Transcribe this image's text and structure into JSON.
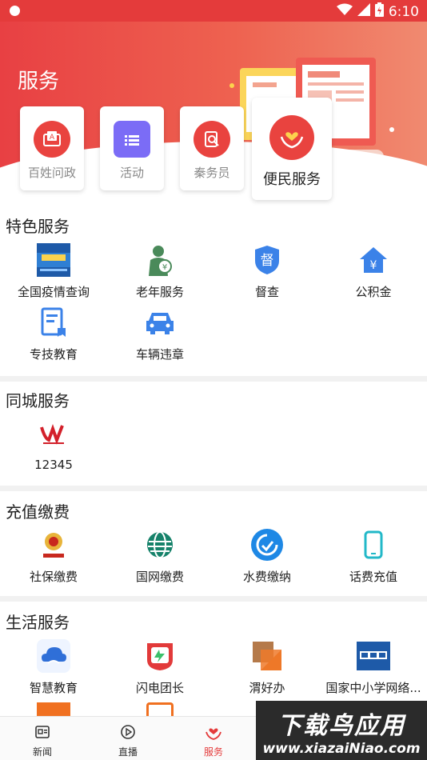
{
  "status_bar": {
    "time": "6:10"
  },
  "header": {
    "title": "服务"
  },
  "quick_links": [
    {
      "label": "百姓问政",
      "icon": "petition-icon",
      "color": "#e9433f"
    },
    {
      "label": "活动",
      "icon": "activity-icon",
      "color": "#7b6cf6"
    },
    {
      "label": "秦务员",
      "icon": "document-search-icon",
      "color": "#e9433f"
    },
    {
      "label": "便民服务",
      "icon": "heart-hands-icon",
      "color": "#e9433f"
    }
  ],
  "sections": {
    "featured": {
      "title": "特色服务",
      "items": [
        {
          "label": "全国疫情查询",
          "icon": "epidemic-map-icon"
        },
        {
          "label": "老年服务",
          "icon": "elderly-icon"
        },
        {
          "label": "督查",
          "icon": "supervision-badge-icon",
          "badge_text": "督"
        },
        {
          "label": "公积金",
          "icon": "housing-fund-icon",
          "badge_text": "¥"
        },
        {
          "label": "专技教育",
          "icon": "education-document-icon"
        },
        {
          "label": "车辆违章",
          "icon": "car-icon"
        }
      ]
    },
    "city": {
      "title": "同城服务",
      "items": [
        {
          "label": "12345",
          "icon": "hotline-logo-icon"
        }
      ]
    },
    "payment": {
      "title": "充值缴费",
      "items": [
        {
          "label": "社保缴费",
          "icon": "tax-emblem-icon"
        },
        {
          "label": "国网缴费",
          "icon": "state-grid-icon"
        },
        {
          "label": "水费缴纳",
          "icon": "water-drop-icon"
        },
        {
          "label": "话费充值",
          "icon": "phone-icon"
        }
      ]
    },
    "life": {
      "title": "生活服务",
      "items": [
        {
          "label": "智慧教育",
          "icon": "cloud-education-icon"
        },
        {
          "label": "闪电团长",
          "icon": "lightning-shop-icon"
        },
        {
          "label": "渭好办",
          "icon": "weihaoban-icon"
        },
        {
          "label": "国家中小学网络...",
          "icon": "cloud-platform-icon"
        }
      ]
    }
  },
  "bottom_nav": [
    {
      "label": "新闻",
      "icon": "news-icon"
    },
    {
      "label": "直播",
      "icon": "live-play-icon"
    },
    {
      "label": "服务",
      "icon": "service-heart-icon",
      "active": true
    }
  ],
  "watermark": {
    "title": "下载鸟应用",
    "url": "www.xiazaiNiao.com"
  },
  "colors": {
    "brand_red": "#e43b3b",
    "accent_blue": "#1e88e5"
  }
}
